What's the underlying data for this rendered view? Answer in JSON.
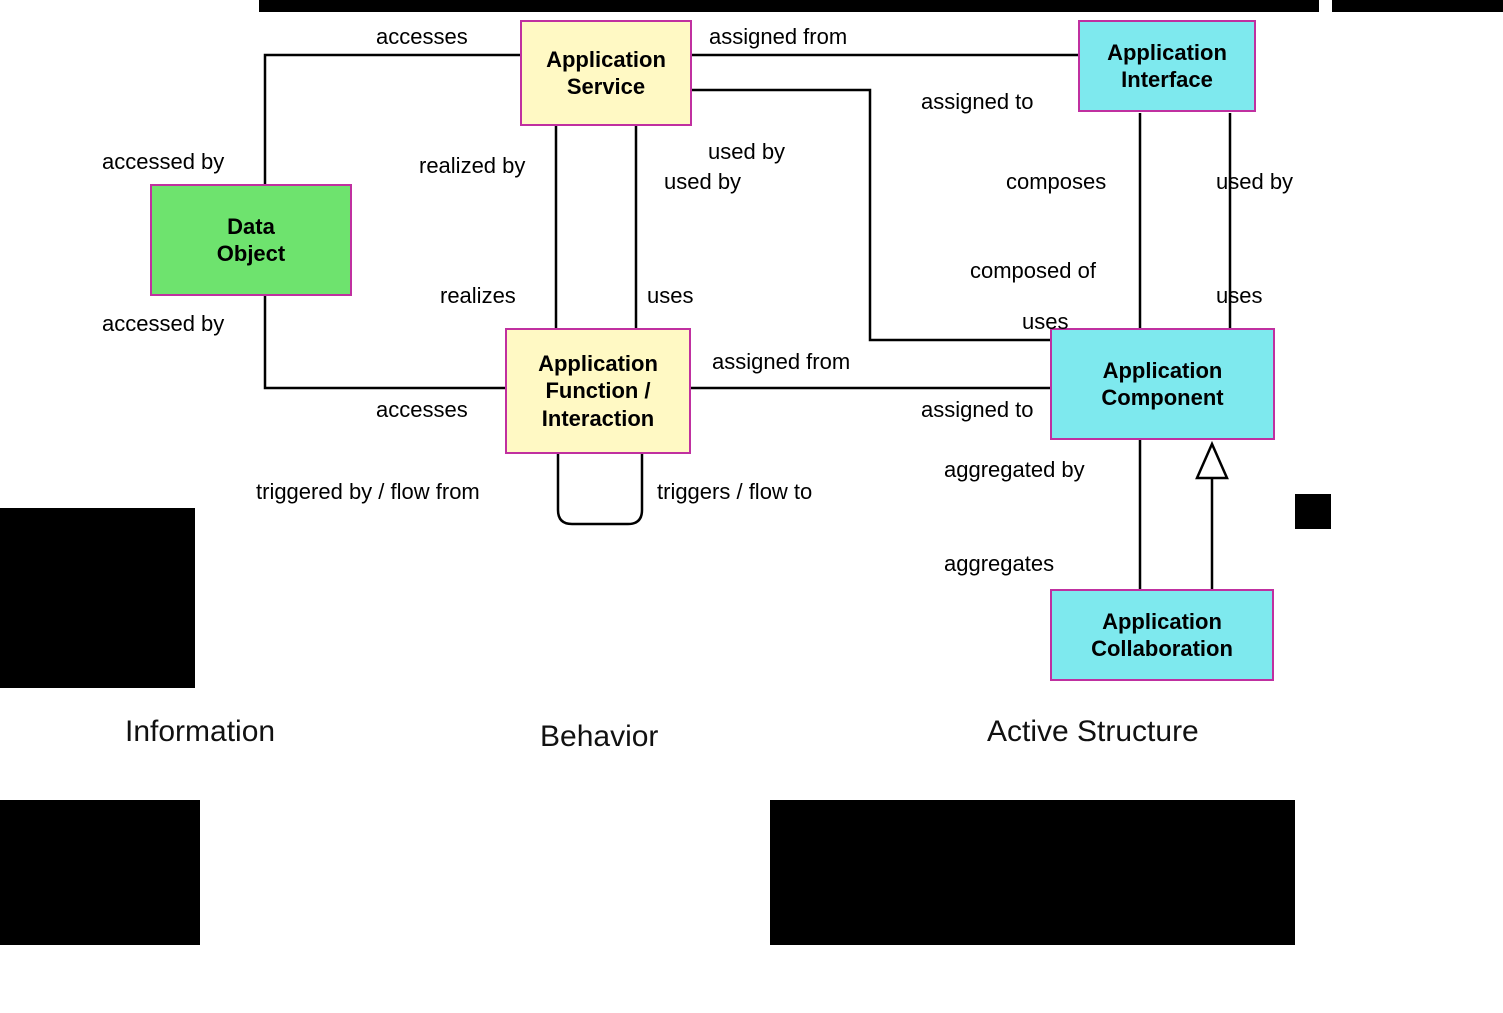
{
  "nodes": {
    "data_object": "Data\nObject",
    "app_service": "Application\nService",
    "app_function": "Application\nFunction /\nInteraction",
    "app_interface": "Application\nInterface",
    "app_component": "Application\nComponent",
    "app_collab": "Application\nCollaboration"
  },
  "edges": {
    "e1": "accesses",
    "e2": "assigned from",
    "e3": "accessed by",
    "e4": "realized by",
    "e5": "used by",
    "e6": "used by",
    "e7": "assigned to",
    "e8": "composes",
    "e9": "used by",
    "e10": "realizes",
    "e11": "uses",
    "e12": "composed of",
    "e13": "uses",
    "e14": "uses",
    "e15": "accessed by",
    "e16": "assigned from",
    "e17": "accesses",
    "e18": "assigned to",
    "e19": "triggered by / flow from",
    "e20": "triggers / flow to",
    "e21": "aggregated by",
    "e22": "aggregates"
  },
  "categories": {
    "left": "Information",
    "mid": "Behavior",
    "right": "Active Structure"
  }
}
